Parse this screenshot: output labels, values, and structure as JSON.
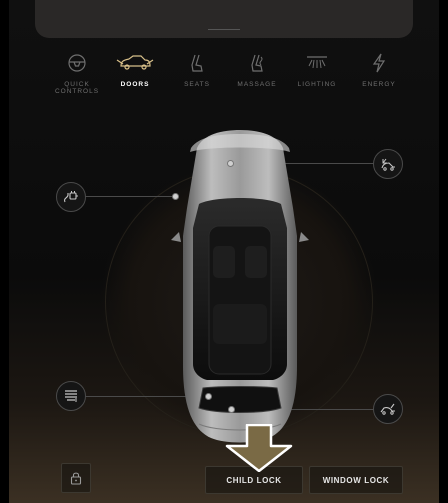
{
  "tabs": [
    {
      "id": "quick-controls",
      "label": "QUICK\nCONTROLS",
      "icon": "steering-wheel-icon",
      "active": false
    },
    {
      "id": "doors",
      "label": "DOORS",
      "icon": "car-doors-icon",
      "active": true
    },
    {
      "id": "seats",
      "label": "SEATS",
      "icon": "seat-icon",
      "active": false
    },
    {
      "id": "massage",
      "label": "MASSAGE",
      "icon": "massage-seat-icon",
      "active": false
    },
    {
      "id": "lighting",
      "label": "LIGHTING",
      "icon": "light-icon",
      "active": false
    },
    {
      "id": "energy",
      "label": "ENERGY",
      "icon": "lightning-icon",
      "active": false
    }
  ],
  "controls": {
    "charge_port_icon": "charge-port-icon",
    "front_trunk_icon": "frunk-open-icon",
    "sunshade_icon": "sunshade-icon",
    "rear_trunk_icon": "trunk-open-icon",
    "lock_icon": "padlock-icon"
  },
  "bottom": {
    "child_lock_label": "CHILD LOCK",
    "window_lock_label": "WINDOW LOCK"
  },
  "colors": {
    "accent": "#d8c08a",
    "arrow": "#7a6a45",
    "active_tab": "#ffffff",
    "inactive_tab": "#6f6f6f"
  }
}
